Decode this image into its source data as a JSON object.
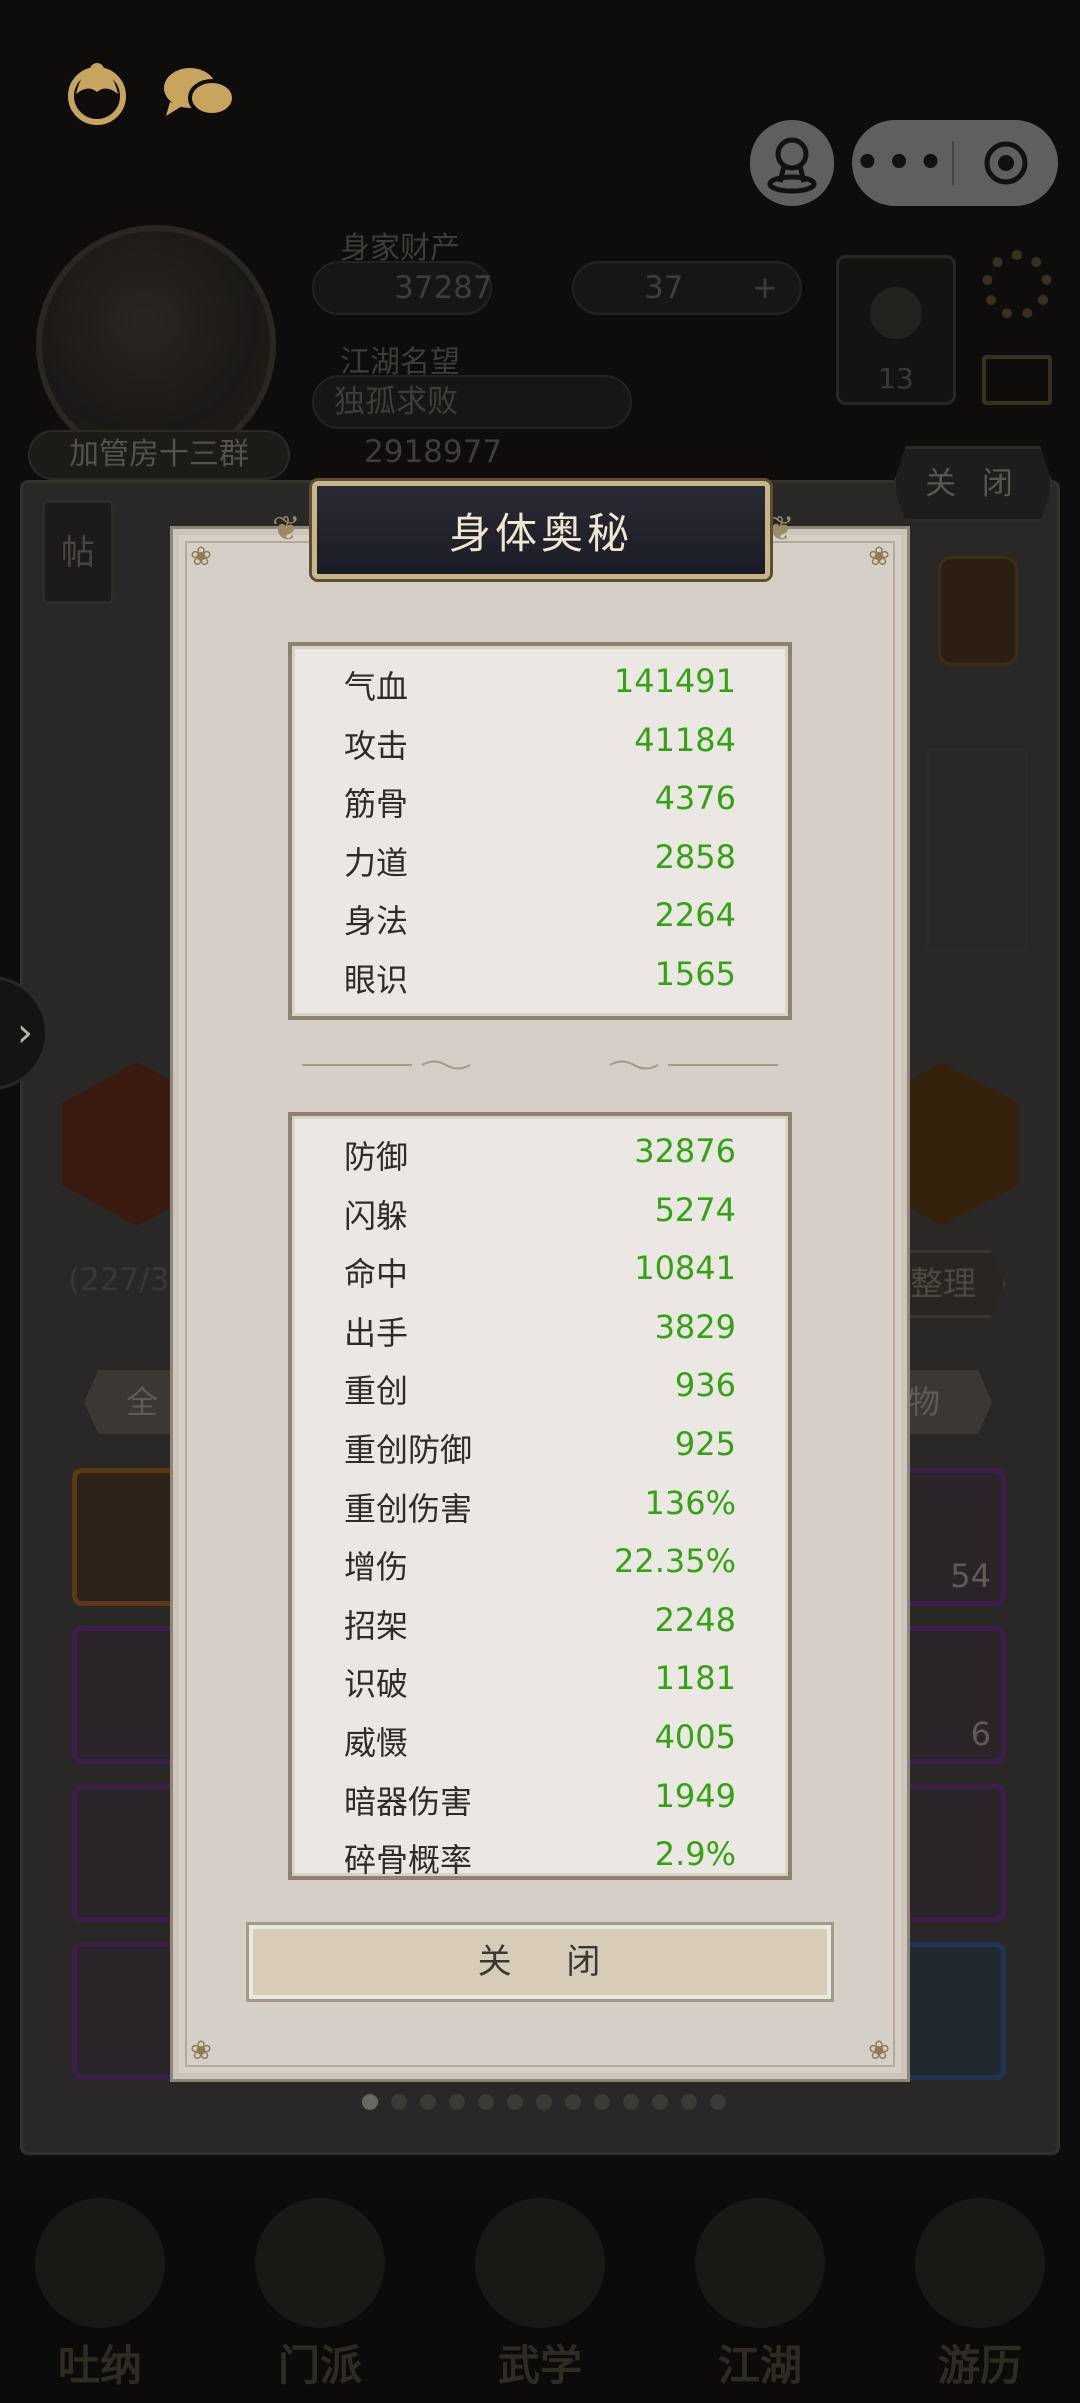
{
  "profile": {
    "wealth_label": "身家财产",
    "silver": "37287",
    "ingots": "37",
    "plus": "+",
    "reputation_label": "江湖名望",
    "title": "独孤求败",
    "reputation": "2918977",
    "guild": "加管房十三群",
    "badge_level": "13"
  },
  "outer_close": "关 闭",
  "side_tag": "帖",
  "sort_button": "整理",
  "left_tab": "全",
  "right_tab": "物",
  "capacity": "(227/3",
  "slot_counts": [
    "54",
    "6"
  ],
  "pager": {
    "total": 13,
    "active": 0
  },
  "nav": [
    "吐纳",
    "门派",
    "武学",
    "江湖",
    "游历"
  ],
  "modal": {
    "title": "身体奥秘",
    "close_button": "关 闭",
    "primary_stats": [
      {
        "name": "气血",
        "value": "141491"
      },
      {
        "name": "攻击",
        "value": "41184"
      },
      {
        "name": "筋骨",
        "value": "4376"
      },
      {
        "name": "力道",
        "value": "2858"
      },
      {
        "name": "身法",
        "value": "2264"
      },
      {
        "name": "眼识",
        "value": "1565"
      }
    ],
    "secondary_stats": [
      {
        "name": "防御",
        "value": "32876"
      },
      {
        "name": "闪躲",
        "value": "5274"
      },
      {
        "name": "命中",
        "value": "10841"
      },
      {
        "name": "出手",
        "value": "3829"
      },
      {
        "name": "重创",
        "value": "936"
      },
      {
        "name": "重创防御",
        "value": "925"
      },
      {
        "name": "重创伤害",
        "value": "136%"
      },
      {
        "name": "增伤",
        "value": "22.35%"
      },
      {
        "name": "招架",
        "value": "2248"
      },
      {
        "name": "识破",
        "value": "1181"
      },
      {
        "name": "威慑",
        "value": "4005"
      },
      {
        "name": "暗器伤害",
        "value": "1949"
      },
      {
        "name": "碎骨概率",
        "value": "2.9%"
      }
    ]
  },
  "colors": {
    "stat_value": "#34a313",
    "modal_bg": "#d6cfc8",
    "title_plate": "#1f1f2b"
  }
}
